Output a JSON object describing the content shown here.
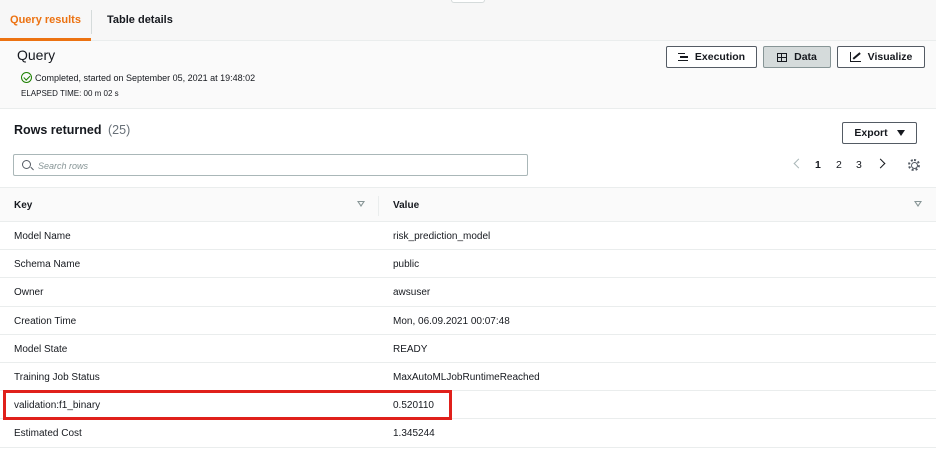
{
  "tabs": {
    "query_results": "Query results",
    "table_details": "Table details"
  },
  "query": {
    "title": "Query",
    "status": "Completed, started on September 05, 2021 at 19:48:02",
    "elapsed": "ELAPSED TIME: 00 m 02 s",
    "buttons": {
      "execution": "Execution",
      "data": "Data",
      "visualize": "Visualize"
    }
  },
  "rows": {
    "title": "Rows returned",
    "count": "(25)",
    "export_label": "Export",
    "search_placeholder": "Search rows",
    "pages": [
      "1",
      "2",
      "3"
    ],
    "current_page": "1"
  },
  "table": {
    "columns": [
      "Key",
      "Value"
    ],
    "rows": [
      {
        "key": "Model Name",
        "value": "risk_prediction_model"
      },
      {
        "key": "Schema Name",
        "value": "public"
      },
      {
        "key": "Owner",
        "value": "awsuser"
      },
      {
        "key": "Creation Time",
        "value": "Mon, 06.09.2021 00:07:48"
      },
      {
        "key": "Model State",
        "value": "READY"
      },
      {
        "key": "Training Job Status",
        "value": "MaxAutoMLJobRuntimeReached"
      },
      {
        "key": "validation:f1_binary",
        "value": "0.520110"
      },
      {
        "key": "Estimated Cost",
        "value": "1.345244"
      }
    ]
  },
  "colors": {
    "accent": "#ec7211",
    "success": "#1d8102",
    "highlight": "#e0201b"
  }
}
